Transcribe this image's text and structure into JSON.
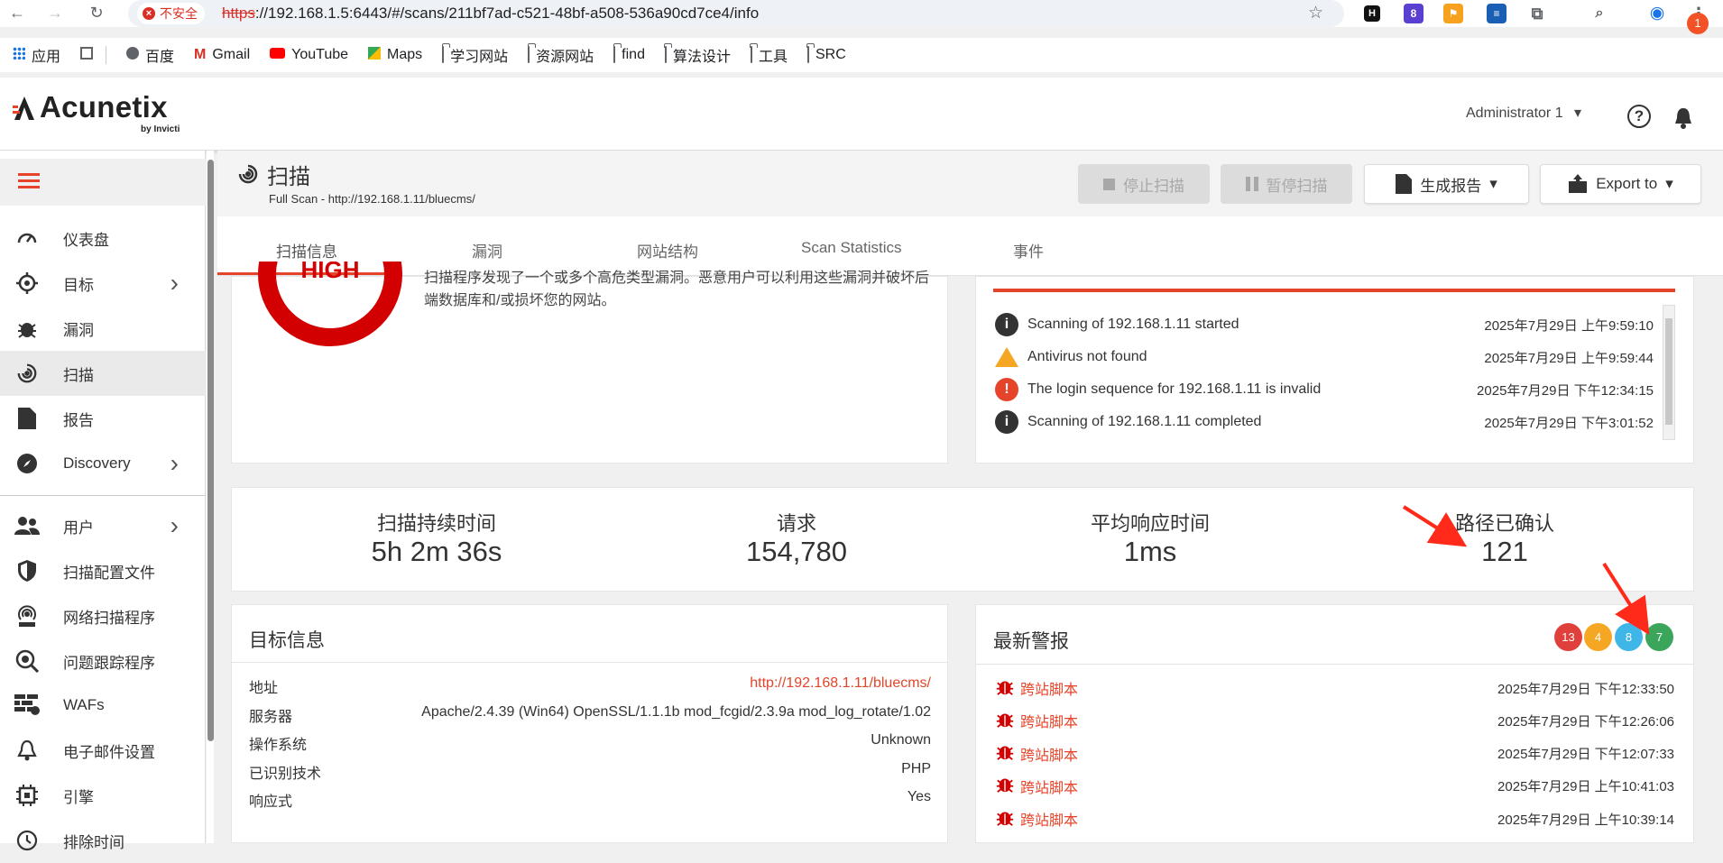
{
  "browser": {
    "insecure_label": "不安全",
    "url_scheme": "https",
    "url_rest": "://192.168.1.5:6443/#/scans/211bf7ad-c521-48bf-a508-536a90cd7ce4/info",
    "ext_badge": "8"
  },
  "bookmarks": [
    {
      "label": "应用",
      "icon": "apps-grid-icon"
    },
    {
      "label": "",
      "icon": "tab-grid-icon"
    },
    {
      "label": "百度",
      "icon": "globe-icon"
    },
    {
      "label": "Gmail",
      "icon": "gmail-icon"
    },
    {
      "label": "YouTube",
      "icon": "youtube-icon"
    },
    {
      "label": "Maps",
      "icon": "maps-icon"
    },
    {
      "label": "学习网站",
      "icon": "folder-icon"
    },
    {
      "label": "资源网站",
      "icon": "folder-icon"
    },
    {
      "label": "find",
      "icon": "folder-icon"
    },
    {
      "label": "算法设计",
      "icon": "folder-icon"
    },
    {
      "label": "工具",
      "icon": "folder-icon"
    },
    {
      "label": "SRC",
      "icon": "folder-icon"
    }
  ],
  "header": {
    "logo": "Acunetix",
    "logo_sub": "by Invicti",
    "user": "Administrator 1",
    "notifications": "1"
  },
  "sidebar": {
    "items": [
      {
        "label": "仪表盘",
        "icon": "dashboard-icon",
        "chevron": false
      },
      {
        "label": "目标",
        "icon": "target-icon",
        "chevron": true
      },
      {
        "label": "漏洞",
        "icon": "bug-icon",
        "chevron": false
      },
      {
        "label": "扫描",
        "icon": "scan-radar-icon",
        "chevron": false,
        "active": true
      },
      {
        "label": "报告",
        "icon": "report-icon",
        "chevron": false
      },
      {
        "label": "Discovery",
        "icon": "compass-icon",
        "chevron": true
      },
      {
        "label": "用户",
        "icon": "users-icon",
        "chevron": true
      },
      {
        "label": "扫描配置文件",
        "icon": "shield-icon",
        "chevron": false
      },
      {
        "label": "网络扫描程序",
        "icon": "network-scanner-icon",
        "chevron": false
      },
      {
        "label": "问题跟踪程序",
        "icon": "issue-tracker-icon",
        "chevron": false
      },
      {
        "label": "WAFs",
        "icon": "waf-icon",
        "chevron": false
      },
      {
        "label": "电子邮件设置",
        "icon": "bell-icon",
        "chevron": false
      },
      {
        "label": "引擎",
        "icon": "engine-icon",
        "chevron": false
      },
      {
        "label": "排除时间",
        "icon": "clock-icon",
        "chevron": false
      }
    ]
  },
  "scan": {
    "title": "扫描",
    "subtitle": "Full Scan - http://192.168.1.11/bluecms/",
    "buttons": {
      "stop": "停止扫描",
      "pause": "暂停扫描",
      "report": "生成报告",
      "export": "Export to"
    }
  },
  "tabs": [
    "扫描信息",
    "漏洞",
    "网站结构",
    "Scan Statistics",
    "事件"
  ],
  "threat": {
    "level": "HIGH",
    "description": "扫描程序发现了一个或多个高危类型漏洞。恶意用户可以利用这些漏洞并破坏后端数据库和/或损坏您的网站。"
  },
  "events": [
    {
      "text": "Scanning of 192.168.1.11 started",
      "time": "2025年7月29日 上午9:59:10",
      "type": "info",
      "color": "#333333"
    },
    {
      "text": "Antivirus not found",
      "time": "2025年7月29日 上午9:59:44",
      "type": "warning",
      "color": "#f5a623"
    },
    {
      "text": "The login sequence for 192.168.1.11 is invalid",
      "time": "2025年7月29日 下午12:34:15",
      "type": "error",
      "color": "#e5442a"
    },
    {
      "text": "Scanning of 192.168.1.11 completed",
      "time": "2025年7月29日 下午3:01:52",
      "type": "info",
      "color": "#333333"
    }
  ],
  "stats": [
    {
      "label": "扫描持续时间",
      "value": "5h 2m 36s"
    },
    {
      "label": "请求",
      "value": "154,780"
    },
    {
      "label": "平均响应时间",
      "value": "1ms"
    },
    {
      "label": "路径已确认",
      "value": "121"
    }
  ],
  "target_info": {
    "title": "目标信息",
    "rows": [
      {
        "label": "地址",
        "value": "http://192.168.1.11/bluecms/",
        "link": true
      },
      {
        "label": "服务器",
        "value": "Apache/2.4.39 (Win64) OpenSSL/1.1.1b mod_fcgid/2.3.9a mod_log_rotate/1.02"
      },
      {
        "label": "操作系统",
        "value": "Unknown"
      },
      {
        "label": "已识别技术",
        "value": "PHP"
      },
      {
        "label": "响应式",
        "value": "Yes"
      }
    ]
  },
  "alerts": {
    "title": "最新警报",
    "counts": [
      {
        "value": "13",
        "color": "#e0403c"
      },
      {
        "value": "4",
        "color": "#f5a623"
      },
      {
        "value": "8",
        "color": "#3fb6e8"
      },
      {
        "value": "7",
        "color": "#3ca55c"
      }
    ],
    "items": [
      {
        "name": "跨站脚本",
        "time": "2025年7月29日 下午12:33:50"
      },
      {
        "name": "跨站脚本",
        "time": "2025年7月29日 下午12:26:06"
      },
      {
        "name": "跨站脚本",
        "time": "2025年7月29日 下午12:07:33"
      },
      {
        "name": "跨站脚本",
        "time": "2025年7月29日 上午10:41:03"
      },
      {
        "name": "跨站脚本",
        "time": "2025年7月29日 上午10:39:14"
      }
    ]
  },
  "colors": {
    "accent": "#e5442a",
    "high": "#d20000"
  }
}
